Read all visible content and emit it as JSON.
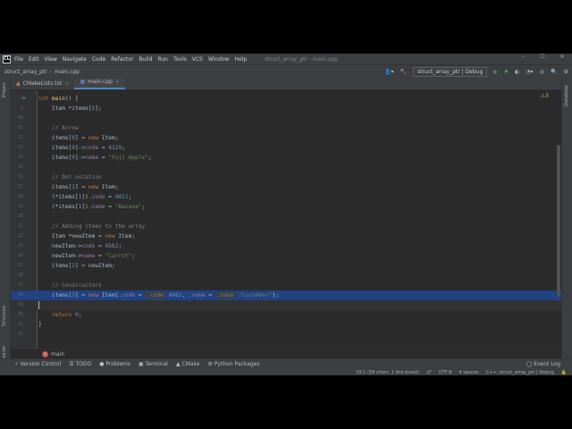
{
  "title_bar": {
    "logo": "CL",
    "menu": [
      "File",
      "Edit",
      "View",
      "Navigate",
      "Code",
      "Refactor",
      "Build",
      "Run",
      "Tools",
      "VCS",
      "Window",
      "Help"
    ],
    "window_title": "struct_array_ptr - main.cpp"
  },
  "nav": {
    "project": "struct_array_ptr",
    "file": "main.cpp",
    "run_config": "struct_array_ptr | Debug"
  },
  "tabs": [
    {
      "label": "CMakeLists.txt"
    },
    {
      "label": "main.cpp"
    }
  ],
  "editor": {
    "warnings": "3",
    "lines": [
      {
        "n": "8",
        "t": [
          [
            "kw",
            "int "
          ],
          [
            "fn",
            "main"
          ],
          [
            "",
            "() {"
          ]
        ]
      },
      {
        "n": "9",
        "t": [
          [
            "",
            "    Item *items["
          ],
          [
            "num",
            "5"
          ],
          [
            "",
            "];"
          ]
        ]
      },
      {
        "n": "10",
        "t": []
      },
      {
        "n": "11",
        "t": [
          [
            "cm",
            "    // Arrow"
          ]
        ]
      },
      {
        "n": "12",
        "t": [
          [
            "",
            "    items["
          ],
          [
            "num",
            "0"
          ],
          [
            "",
            "] = "
          ],
          [
            "kw",
            "new "
          ],
          [
            "",
            "Item;"
          ]
        ]
      },
      {
        "n": "13",
        "t": [
          [
            "",
            "    items["
          ],
          [
            "num",
            "0"
          ],
          [
            "",
            "]->"
          ],
          [
            "fld",
            "code"
          ],
          [
            "",
            " = "
          ],
          [
            "num",
            "4129"
          ],
          [
            "",
            ";"
          ]
        ]
      },
      {
        "n": "14",
        "t": [
          [
            "",
            "    items["
          ],
          [
            "num",
            "0"
          ],
          [
            "",
            "]->"
          ],
          [
            "fld",
            "name"
          ],
          [
            "",
            " = "
          ],
          [
            "str",
            "\"Fuji Apple\""
          ],
          [
            "",
            ";"
          ]
        ]
      },
      {
        "n": "15",
        "t": []
      },
      {
        "n": "16",
        "t": [
          [
            "cm",
            "    // Dot notation"
          ]
        ]
      },
      {
        "n": "17",
        "t": [
          [
            "",
            "    items["
          ],
          [
            "num",
            "1"
          ],
          [
            "",
            "] = "
          ],
          [
            "kw",
            "new "
          ],
          [
            "",
            "Item;"
          ]
        ]
      },
      {
        "n": "18",
        "t": [
          [
            "",
            "    (*items["
          ],
          [
            "num",
            "1"
          ],
          [
            "",
            "])."
          ],
          [
            "fld",
            "code"
          ],
          [
            "",
            " = "
          ],
          [
            "num",
            "4011"
          ],
          [
            "",
            ";"
          ]
        ]
      },
      {
        "n": "19",
        "t": [
          [
            "",
            "    (*items["
          ],
          [
            "num",
            "1"
          ],
          [
            "",
            "])."
          ],
          [
            "fld",
            "name"
          ],
          [
            "",
            " = "
          ],
          [
            "str",
            "\"Banana\""
          ],
          [
            "",
            ";"
          ]
        ]
      },
      {
        "n": "20",
        "t": []
      },
      {
        "n": "21",
        "t": [
          [
            "cm",
            "    // Adding items to the array"
          ]
        ]
      },
      {
        "n": "22",
        "t": [
          [
            "",
            "    Item *newItem = "
          ],
          [
            "kw",
            "new "
          ],
          [
            "",
            "Item;"
          ]
        ]
      },
      {
        "n": "23",
        "t": [
          [
            "",
            "    newItem->"
          ],
          [
            "fld",
            "code"
          ],
          [
            "",
            " = "
          ],
          [
            "num",
            "4562"
          ],
          [
            "",
            ";"
          ]
        ]
      },
      {
        "n": "24",
        "t": [
          [
            "",
            "    newItem->"
          ],
          [
            "fld",
            "name"
          ],
          [
            "",
            " = "
          ],
          [
            "str",
            "\"Carrot\""
          ],
          [
            "",
            ";"
          ]
        ]
      },
      {
        "n": "25",
        "t": [
          [
            "",
            "    items["
          ],
          [
            "num",
            "2"
          ],
          [
            "",
            "] = newItem;"
          ]
        ]
      },
      {
        "n": "26",
        "t": []
      },
      {
        "n": "27",
        "t": [
          [
            "cm",
            "    // Constructors"
          ]
        ]
      },
      {
        "n": "28",
        "t": [
          [
            "",
            "    items["
          ],
          [
            "num",
            "3"
          ],
          [
            "",
            "] = "
          ],
          [
            "kw",
            "new "
          ],
          [
            "",
            "Item{."
          ],
          [
            "fld",
            "code"
          ],
          [
            "",
            " = "
          ],
          [
            "hint",
            ".code"
          ],
          [
            "num",
            " 4062"
          ],
          [
            "",
            ", ."
          ],
          [
            "fld",
            "name"
          ],
          [
            "",
            " = "
          ],
          [
            "hint",
            ".name"
          ],
          [
            "str",
            " \"Cucumber\""
          ],
          [
            "",
            "};"
          ]
        ]
      },
      {
        "n": "29",
        "t": []
      },
      {
        "n": "30",
        "t": [
          [
            "kw",
            "    return "
          ],
          [
            "num",
            "0"
          ],
          [
            "",
            ";"
          ]
        ]
      },
      {
        "n": "31",
        "t": [
          [
            "",
            "}"
          ]
        ]
      },
      {
        "n": "32",
        "t": []
      }
    ]
  },
  "breadcrumb": {
    "badge": "f",
    "label": "main"
  },
  "side": {
    "left_top": "Project",
    "left_mid": "Structure",
    "left_bottom": "Bookmarks",
    "right": "Database"
  },
  "tool_windows": [
    "Version Control",
    "TODO",
    "Problems",
    "Terminal",
    "CMake",
    "Python Packages"
  ],
  "event_log": "Event Log",
  "status": {
    "position": "29:1 (59 chars, 1 line break)",
    "line_sep": "LF",
    "encoding": "UTF-8",
    "indent": "4 spaces",
    "context": "C++: struct_array_ptr | Debug"
  }
}
